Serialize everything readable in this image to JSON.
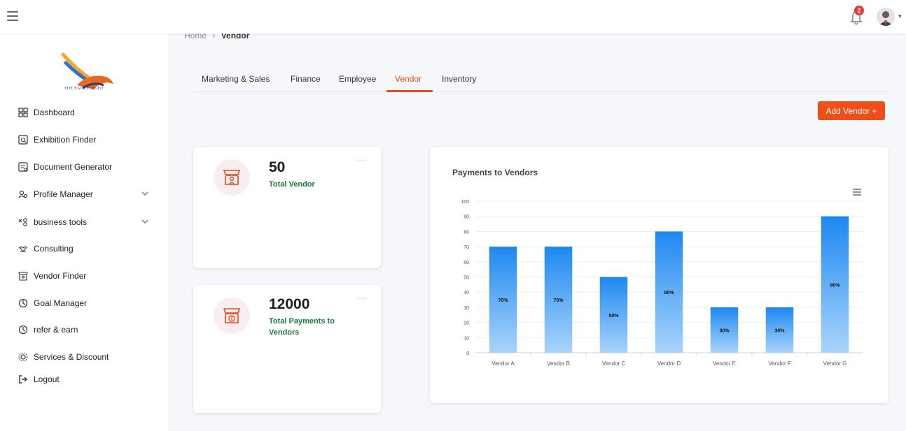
{
  "header": {
    "notification_count": "2"
  },
  "sidebar": {
    "logo_text": "THE EAGLE SIGHT",
    "items": [
      {
        "label": "Dashboard",
        "icon": "grid-icon"
      },
      {
        "label": "Exhibition Finder",
        "icon": "search-doc-icon"
      },
      {
        "label": "Document Generator",
        "icon": "doc-gen-icon"
      },
      {
        "label": "Profile Manager",
        "icon": "users-icon",
        "expandable": true
      },
      {
        "label": "business tools",
        "icon": "tools-icon",
        "expandable": true
      },
      {
        "label": "Consulting",
        "icon": "handshake-icon"
      },
      {
        "label": "Vendor Finder",
        "icon": "store-icon"
      },
      {
        "label": "Goal Manager",
        "icon": "target-icon"
      },
      {
        "label": "refer & earn",
        "icon": "refer-icon"
      },
      {
        "label": "Services & Discount",
        "icon": "gear-icon"
      },
      {
        "label": "Logout",
        "icon": "logout-icon"
      }
    ]
  },
  "breadcrumb": {
    "home": "Home",
    "separator": "›",
    "current": "Vendor"
  },
  "tabs": [
    {
      "label": "Marketing & Sales"
    },
    {
      "label": "Finance"
    },
    {
      "label": "Employee"
    },
    {
      "label": "Vendor",
      "active": true
    },
    {
      "label": "Inventory"
    }
  ],
  "actions": {
    "add_vendor_label": "Add Vendor +"
  },
  "stats": [
    {
      "value": "50",
      "label": "Total Vendor",
      "icon": "store-icon"
    },
    {
      "value": "12000",
      "label": "Total Payments to Vendors",
      "icon": "payment-store-icon"
    }
  ],
  "stat_menu_label": "···",
  "colors": {
    "accent": "#f04e18",
    "stat_label": "#1d7a3c",
    "bar_top": "#1e88f0",
    "bar_bottom": "#a9d4fb"
  },
  "chart_data": {
    "type": "bar",
    "title": "Payments to Vendors",
    "categories": [
      "Vendor A",
      "Vendor B",
      "Vendor C",
      "Vendor D",
      "Vendor E",
      "Vendor F",
      "Vendor G"
    ],
    "values": [
      70,
      70,
      50,
      80,
      30,
      30,
      90
    ],
    "data_labels": [
      "70%",
      "70%",
      "50%",
      "80%",
      "30%",
      "30%",
      "90%"
    ],
    "y_ticks": [
      0,
      10,
      20,
      30,
      40,
      50,
      60,
      70,
      80,
      90,
      100
    ],
    "ylim": [
      0,
      100
    ],
    "grid": true,
    "legend": "none"
  }
}
